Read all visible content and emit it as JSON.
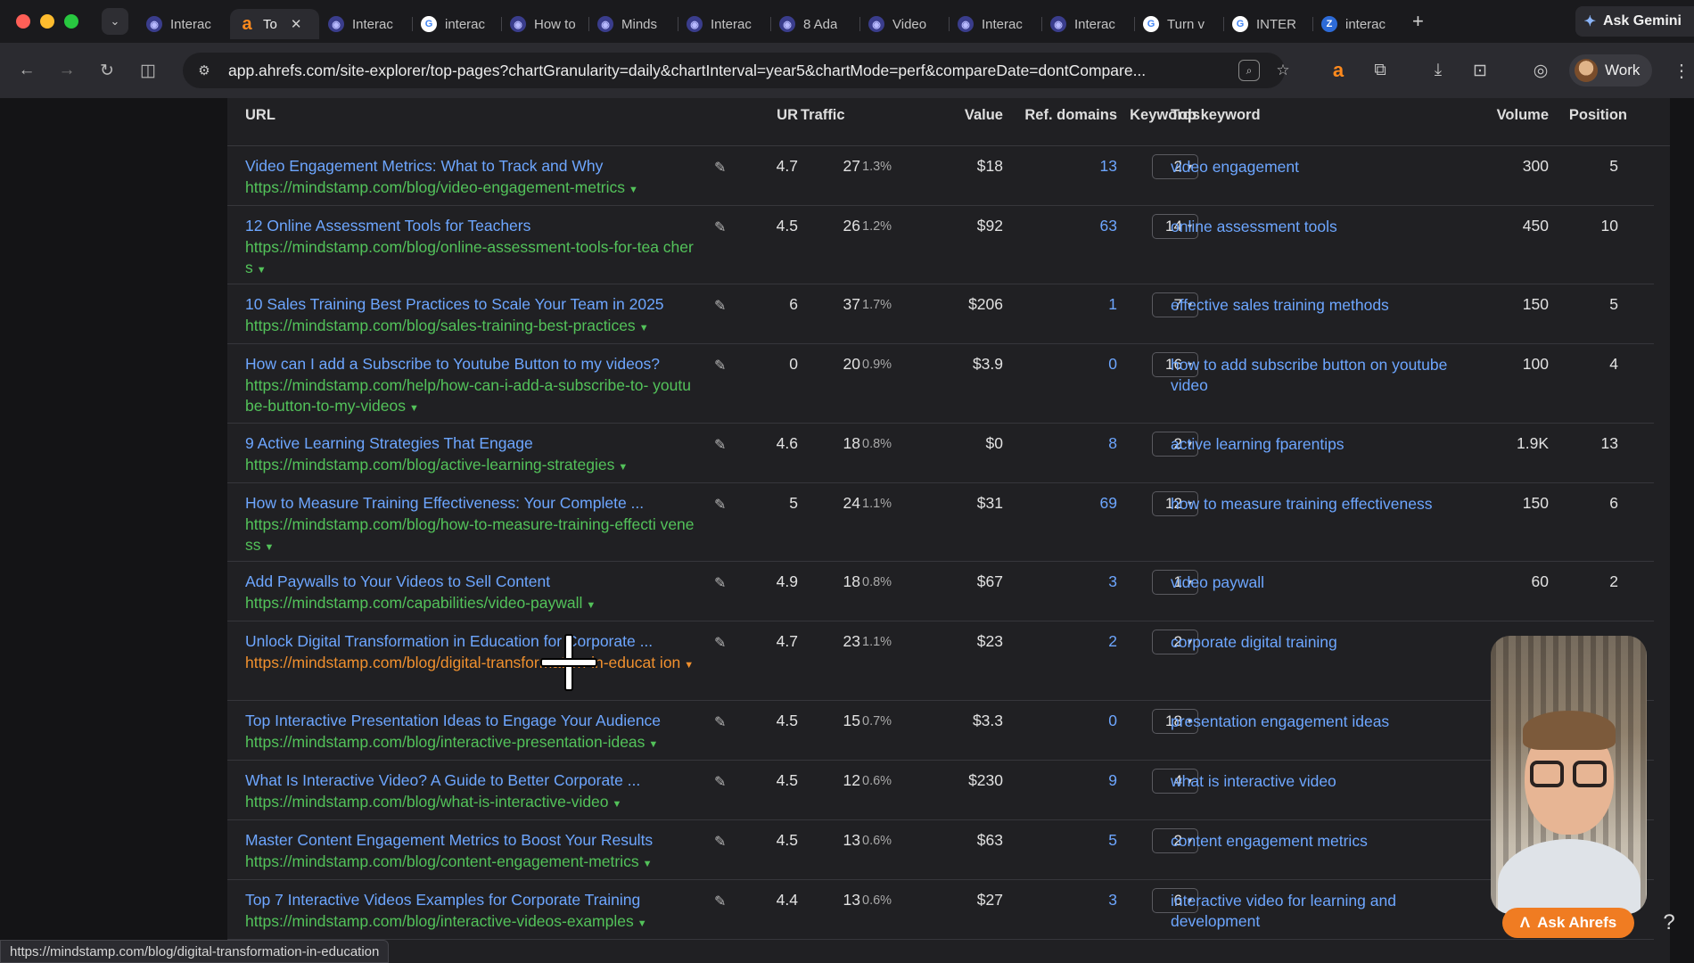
{
  "window": {
    "tabs": [
      {
        "label": "Interac",
        "icon": "mindstamp"
      },
      {
        "label": "To",
        "icon": "ahrefs",
        "active": true
      },
      {
        "label": "Interac",
        "icon": "mindstamp"
      },
      {
        "label": "interac",
        "icon": "google"
      },
      {
        "label": "How to",
        "icon": "mindstamp"
      },
      {
        "label": "Minds",
        "icon": "mindstamp"
      },
      {
        "label": "Interac",
        "icon": "mindstamp"
      },
      {
        "label": "8 Ada",
        "icon": "mindstamp"
      },
      {
        "label": "Video",
        "icon": "mindstamp"
      },
      {
        "label": "Interac",
        "icon": "mindstamp"
      },
      {
        "label": "Interac",
        "icon": "mindstamp"
      },
      {
        "label": "Turn v",
        "icon": "google"
      },
      {
        "label": "INTER",
        "icon": "google"
      },
      {
        "label": "interac",
        "icon": "edge"
      }
    ],
    "ask_gemini": "Ask Gemini",
    "url": "app.ahrefs.com/site-explorer/top-pages?chartGranularity=daily&chartInterval=year5&chartMode=perf&compareDate=dontCompare...",
    "profile_label": "Work"
  },
  "table": {
    "headers": {
      "url": "URL",
      "ur": "UR",
      "traffic": "Traffic",
      "value": "Value",
      "ref_domains": "Ref. domains",
      "keywords": "Keywords",
      "top_keyword": "Top keyword",
      "volume": "Volume",
      "position": "Position"
    },
    "rows": [
      {
        "title": "Video Engagement Metrics: What to Track and Why",
        "url": "https://mindstamp.com/blog/video-engagement-metrics",
        "ur": "4.7",
        "traffic": "27",
        "pct": "1.3%",
        "value": "$18",
        "ref_domains": "13",
        "keywords": "2",
        "top_keyword": "video engagement",
        "volume": "300",
        "position": "5"
      },
      {
        "title": "12 Online Assessment Tools for Teachers",
        "url": "https://mindstamp.com/blog/online-assessment-tools-for-tea chers",
        "ur": "4.5",
        "traffic": "26",
        "pct": "1.2%",
        "value": "$92",
        "ref_domains": "63",
        "keywords": "14",
        "top_keyword": "online assessment tools",
        "volume": "450",
        "position": "10"
      },
      {
        "title": "10 Sales Training Best Practices to Scale Your Team in 2025",
        "url": "https://mindstamp.com/blog/sales-training-best-practices",
        "ur": "6",
        "traffic": "37",
        "pct": "1.7%",
        "value": "$206",
        "ref_domains": "1",
        "keywords": "7",
        "top_keyword": "effective sales training methods",
        "volume": "150",
        "position": "5"
      },
      {
        "title": "How can I add a Subscribe to Youtube Button to my videos?",
        "url": "https://mindstamp.com/help/how-can-i-add-a-subscribe-to- youtube-button-to-my-videos",
        "ur": "0",
        "traffic": "20",
        "pct": "0.9%",
        "value": "$3.9",
        "ref_domains": "0",
        "keywords": "16",
        "top_keyword": "how to add subscribe button on youtube video",
        "volume": "100",
        "position": "4"
      },
      {
        "title": "9 Active Learning Strategies That Engage",
        "url": "https://mindstamp.com/blog/active-learning-strategies",
        "ur": "4.6",
        "traffic": "18",
        "pct": "0.8%",
        "value": "$0",
        "ref_domains": "8",
        "keywords": "2",
        "top_keyword": "active learning fparentips",
        "volume": "1.9K",
        "position": "13"
      },
      {
        "title": "How to Measure Training Effectiveness: Your Complete ...",
        "url": "https://mindstamp.com/blog/how-to-measure-training-effecti veness",
        "ur": "5",
        "traffic": "24",
        "pct": "1.1%",
        "value": "$31",
        "ref_domains": "69",
        "keywords": "12",
        "top_keyword": "how to measure training effectiveness",
        "volume": "150",
        "position": "6"
      },
      {
        "title": "Add Paywalls to Your Videos to Sell Content",
        "url": "https://mindstamp.com/capabilities/video-paywall",
        "ur": "4.9",
        "traffic": "18",
        "pct": "0.8%",
        "value": "$67",
        "ref_domains": "3",
        "keywords": "1",
        "top_keyword": "video paywall",
        "volume": "60",
        "position": "2"
      },
      {
        "title": "Unlock Digital Transformation in Education for Corporate ...",
        "url": "https://mindstamp.com/blog/digital-transformation-in-educat ion",
        "ur": "4.7",
        "traffic": "23",
        "pct": "1.1%",
        "value": "$23",
        "ref_domains": "2",
        "keywords": "2",
        "top_keyword": "corporate digital training",
        "volume": "",
        "position": "",
        "visited": true
      },
      {
        "title": "Top Interactive Presentation Ideas to Engage Your Audience",
        "url": "https://mindstamp.com/blog/interactive-presentation-ideas",
        "ur": "4.5",
        "traffic": "15",
        "pct": "0.7%",
        "value": "$3.3",
        "ref_domains": "0",
        "keywords": "18",
        "top_keyword": "presentation engagement ideas",
        "volume": "",
        "position": ""
      },
      {
        "title": "What Is Interactive Video? A Guide to Better Corporate ...",
        "url": "https://mindstamp.com/blog/what-is-interactive-video",
        "ur": "4.5",
        "traffic": "12",
        "pct": "0.6%",
        "value": "$230",
        "ref_domains": "9",
        "keywords": "4",
        "top_keyword": "what is interactive video",
        "volume": "",
        "position": ""
      },
      {
        "title": "Master Content Engagement Metrics to Boost Your Results",
        "url": "https://mindstamp.com/blog/content-engagement-metrics",
        "ur": "4.5",
        "traffic": "13",
        "pct": "0.6%",
        "value": "$63",
        "ref_domains": "5",
        "keywords": "2",
        "top_keyword": "content engagement metrics",
        "volume": "",
        "position": ""
      },
      {
        "title": "Top 7 Interactive Videos Examples for Corporate Training",
        "url": "https://mindstamp.com/blog/interactive-videos-examples",
        "ur": "4.4",
        "traffic": "13",
        "pct": "0.6%",
        "value": "$27",
        "ref_domains": "3",
        "keywords": "6",
        "top_keyword": "interactive video for learning and development",
        "volume": "",
        "position": ""
      }
    ]
  },
  "overlay": {
    "ask_ahrefs": "Ask Ahrefs",
    "help": "?",
    "status_url": "https://mindstamp.com/blog/digital-transformation-in-education"
  },
  "colors": {
    "link": "#6da6ff",
    "url_green": "#53c25a",
    "url_visited": "#f0902e",
    "brand": "#f07c22"
  }
}
